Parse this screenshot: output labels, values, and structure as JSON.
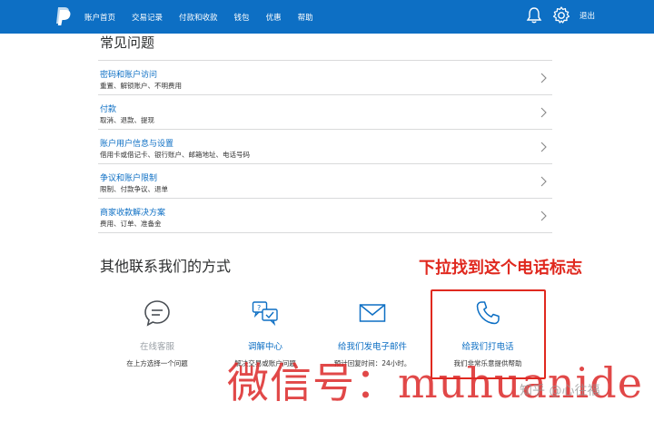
{
  "nav": {
    "items": [
      "账户首页",
      "交易记录",
      "付款和收款",
      "钱包",
      "优惠",
      "帮助"
    ],
    "logout": "退出"
  },
  "faq": {
    "title": "常见问题",
    "rows": [
      {
        "title": "密码和账户访问",
        "sub": "重置、解锁账户、不明费用"
      },
      {
        "title": "付款",
        "sub": "取消、退款、提现"
      },
      {
        "title": "账户用户信息与设置",
        "sub": "借用卡或借记卡、银行账户、邮箱地址、电话号码"
      },
      {
        "title": "争议和账户限制",
        "sub": "限制、付款争议、退单"
      },
      {
        "title": "商家收款解决方案",
        "sub": "费用、订单、准备金"
      }
    ]
  },
  "other": {
    "title": "其他联系我们的方式",
    "annotation": "下拉找到这个电话标志",
    "options": [
      {
        "label": "在线客服",
        "sub": "在上方选择一个问题",
        "icon": "chat-bubble-icon"
      },
      {
        "label": "调解中心",
        "sub": "解决交易或账户问题",
        "icon": "resolution-center-icon"
      },
      {
        "label": "给我们发电子邮件",
        "sub": "预计回复时间：24小时。",
        "icon": "envelope-icon"
      },
      {
        "label": "给我们打电话",
        "sub": "我们非常乐意提供帮助",
        "icon": "phone-icon"
      }
    ]
  },
  "overlay": {
    "watermark": "微信号：muhuanide",
    "zhihu": "知乎 @心往福"
  },
  "colors": {
    "brand_blue": "#0d6fc4",
    "annotation_red": "#e0291f"
  }
}
